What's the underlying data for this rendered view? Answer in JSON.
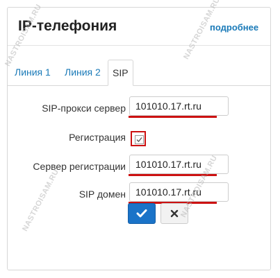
{
  "header": {
    "title": "IP-телефония",
    "more_link": "подробнее"
  },
  "tabs": [
    {
      "label": "Линия 1",
      "active": false
    },
    {
      "label": "Линия 2",
      "active": false
    },
    {
      "label": "SIP",
      "active": true
    }
  ],
  "form": {
    "sip_proxy_label": "SIP-прокси сервер",
    "sip_proxy_value": "101010.17.rt.ru",
    "registration_label": "Регистрация",
    "registration_checked": true,
    "reg_server_label": "Сервер регистрации",
    "reg_server_value": "101010.17.rt.ru",
    "sip_domain_label": "SIP домен",
    "sip_domain_value": "101010.17.rt.ru"
  },
  "buttons": {
    "ok_icon": "checkmark-icon",
    "cancel_icon": "close-icon"
  },
  "watermark": "NASTROISAM.RU",
  "colors": {
    "accent": "#1a73c8",
    "link": "#1a7ab8",
    "highlight": "#cc1111"
  }
}
